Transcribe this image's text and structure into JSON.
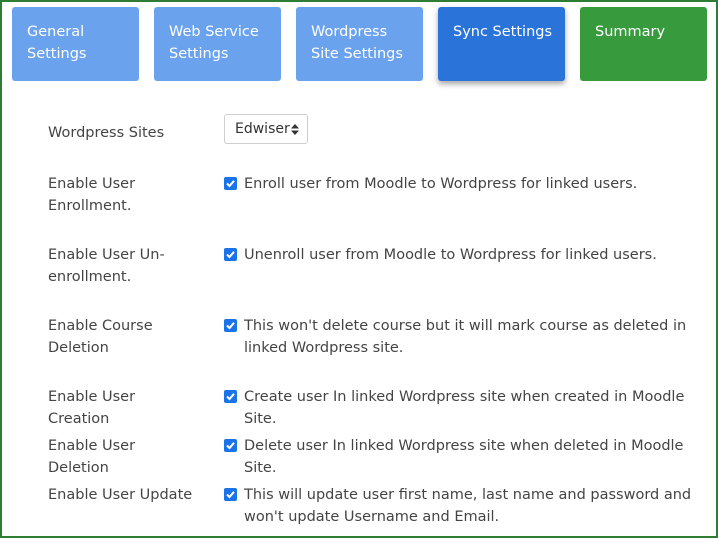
{
  "tabs": [
    {
      "label": "General Settings",
      "state": "light"
    },
    {
      "label": "Web Service Settings",
      "state": "light"
    },
    {
      "label": "Wordpress Site Settings",
      "state": "light"
    },
    {
      "label": "Sync Settings",
      "state": "active"
    },
    {
      "label": "Summary",
      "state": "done"
    }
  ],
  "wordpress_sites": {
    "label": "Wordpress Sites",
    "selected": "Edwiser"
  },
  "settings": [
    {
      "label": "Enable User Enrollment.",
      "description": "Enroll user from Moodle to Wordpress for linked users.",
      "checked": true
    },
    {
      "label": "Enable User Un-enrollment.",
      "description": "Unenroll user from Moodle to Wordpress for linked users.",
      "checked": true
    },
    {
      "label": "Enable Course Deletion",
      "description": "This won't delete course but it will mark course as deleted in linked Wordpress site.",
      "checked": true
    },
    {
      "label": "Enable User Creation",
      "description": "Create user In linked Wordpress site when created in Moodle Site.",
      "checked": true
    },
    {
      "label": "Enable User Deletion",
      "description": "Delete user In linked Wordpress site when deleted in Moodle Site.",
      "checked": true
    },
    {
      "label": "Enable User Update",
      "description": "This will update user first name, last name and password and won't update Username and Email.",
      "checked": true
    }
  ],
  "colors": {
    "tab_light": "#6aa2ee",
    "tab_active": "#2a73d9",
    "tab_done": "#379b3d",
    "checkbox": "#1a73e8",
    "frame": "#2e7d32"
  }
}
